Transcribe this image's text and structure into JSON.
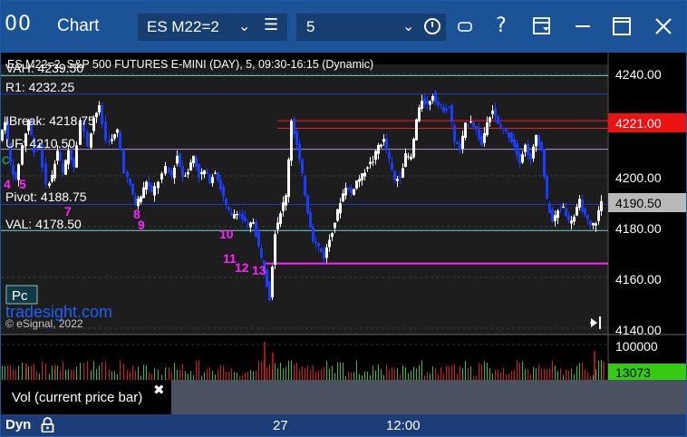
{
  "window": {
    "logo": "00",
    "title": "Chart",
    "symbol": "ES M22=2",
    "interval": "5"
  },
  "chart": {
    "header": "ES M22=2, S&P 500 FUTURES E-MINI (DAY), 5, 09:30-16:15 (Dynamic)",
    "watermark": "tradesight.com",
    "copyright": "© eSignal, 2022",
    "pc_badge": "Pc",
    "levels": [
      {
        "label": "VAH: 4239.50"
      },
      {
        "label": "R1: 4232.25"
      },
      {
        "label": "IBreak: 4218.75"
      },
      {
        "label": "UF: 4210.50"
      },
      {
        "label": "Pivot: 4188.75"
      },
      {
        "label": "VAL: 4178.50"
      }
    ],
    "price_axis": [
      "4240.00",
      "4200.00",
      "4180.00",
      "4160.00",
      "4140.00"
    ],
    "price_marker_red": "4221.00",
    "price_marker_gray": "4190.50",
    "counts": [
      "4",
      "5",
      "7",
      "8",
      "9",
      "10",
      "11",
      "12",
      "13"
    ],
    "count_prefix": "C",
    "colors": {
      "up": "#ffffff",
      "down": "#1a3cff",
      "count": "#ff22ff",
      "red_level": "#ff1a1a",
      "blue_level": "#2438c8",
      "teal_level": "#66d6d6",
      "violet_level": "#b090e0",
      "magenta_level": "#ff22ff"
    }
  },
  "volume": {
    "label": "Vol (current price bar)",
    "axis_top": "100000",
    "current": "13073"
  },
  "xaxis": [
    "27",
    "12:00"
  ],
  "bottom": {
    "dyn": "Dyn"
  }
}
